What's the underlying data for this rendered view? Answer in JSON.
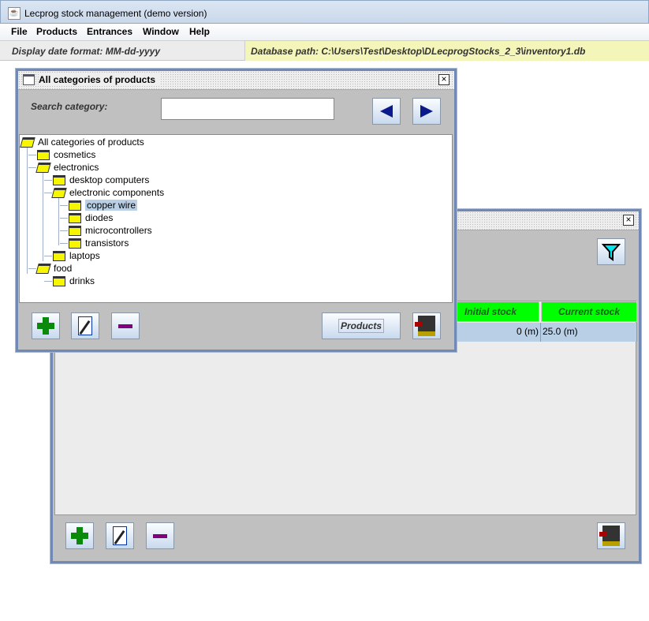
{
  "window": {
    "title": "Lecprog stock management (demo version)"
  },
  "menu": [
    "File",
    "Products",
    "Entrances",
    "Window",
    "Help"
  ],
  "status": {
    "date_format": "Display date format:  MM-dd-yyyy",
    "db_path": "Database path: C:\\Users\\Test\\Desktop\\DLecprogStocks_2_3\\inventory1.db"
  },
  "categories_frame": {
    "title": "All categories of products",
    "search_label": "Search category:",
    "search_value": "",
    "tree": [
      {
        "label": "All categories of products",
        "level": 0,
        "open": true
      },
      {
        "label": "cosmetics",
        "level": 1
      },
      {
        "label": "electronics",
        "level": 1,
        "open": true
      },
      {
        "label": "desktop computers",
        "level": 2
      },
      {
        "label": "electronic components",
        "level": 2,
        "open": true
      },
      {
        "label": "copper wire",
        "level": 3,
        "selected": true
      },
      {
        "label": "diodes",
        "level": 3
      },
      {
        "label": "microcontrollers",
        "level": 3
      },
      {
        "label": "transistors",
        "level": 3
      },
      {
        "label": "laptops",
        "level": 2
      },
      {
        "label": "food",
        "level": 1,
        "open": true
      },
      {
        "label": "drinks",
        "level": 2
      }
    ],
    "products_button": "Products"
  },
  "products_frame": {
    "columns": [
      "Initial stock",
      "Current stock"
    ],
    "rows": [
      [
        "0 (m)",
        "25.0 (m)"
      ]
    ]
  },
  "close_glyph": "☒"
}
